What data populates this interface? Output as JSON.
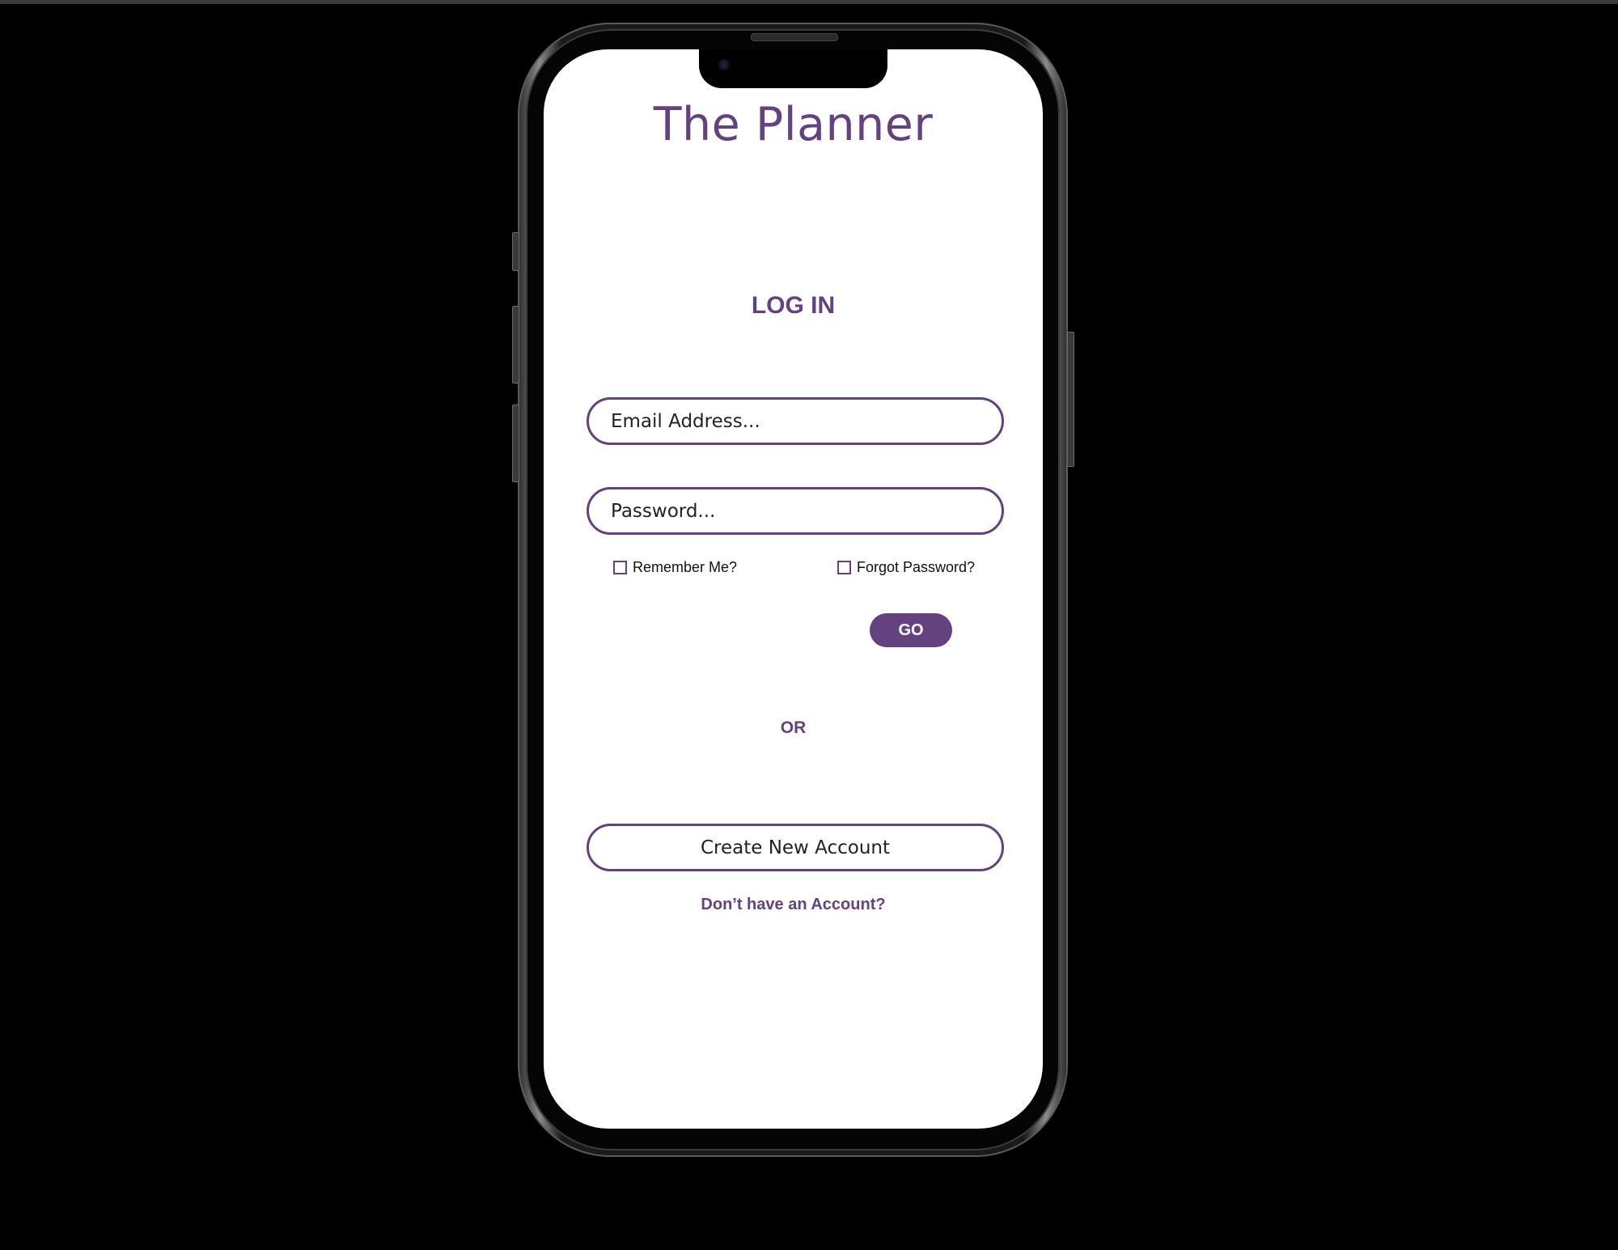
{
  "app": {
    "title": "The Planner",
    "accent_color": "#64427f"
  },
  "login": {
    "heading": "LOG IN",
    "email_placeholder": "Email Address...",
    "password_placeholder": "Password...",
    "remember_label": "Remember Me?",
    "forgot_label": "Forgot Password?",
    "go_label": "GO",
    "or_label": "OR",
    "create_label": "Create New Account",
    "no_account_label": "Don’t have an Account?"
  }
}
